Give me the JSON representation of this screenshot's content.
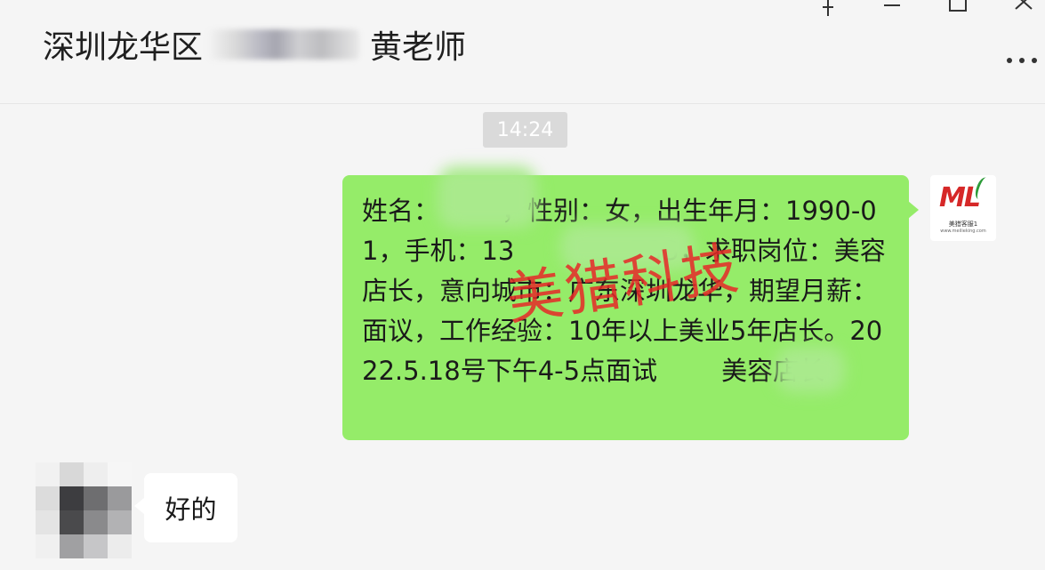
{
  "header": {
    "title_prefix": "深圳龙华区",
    "title_suffix": "黄老师",
    "pin_icon": "pin-icon",
    "minimize_icon": "minimize-icon",
    "maximize_icon": "maximize-icon",
    "close_icon": "close-icon",
    "more_icon": "more-icon"
  },
  "messages": {
    "timestamp": "14:24",
    "outgoing_text": "姓名：",
    "outgoing_text_2": "，性别：女，出生年月：1990-01，手机：13",
    "outgoing_text_3": "733，求职岗位：美容店长，意向城市：广东深圳龙华，期望月薪：面议，工作经验：10年以上美业5年店长。2022.5.18号下午4-5点面试",
    "outgoing_text_4": "美容店长",
    "incoming_text": "好的"
  },
  "watermark": {
    "text": "美猎科技",
    "color": "#e62828"
  },
  "self_avatar": {
    "logo_letters": "ML",
    "logo_caption": "美猎客服1",
    "logo_sub": "www.meilieking.com"
  },
  "colors": {
    "outgoing_bubble": "#95ec69",
    "incoming_bubble": "#ffffff",
    "background": "#f5f5f5",
    "time_badge": "#dadada"
  }
}
